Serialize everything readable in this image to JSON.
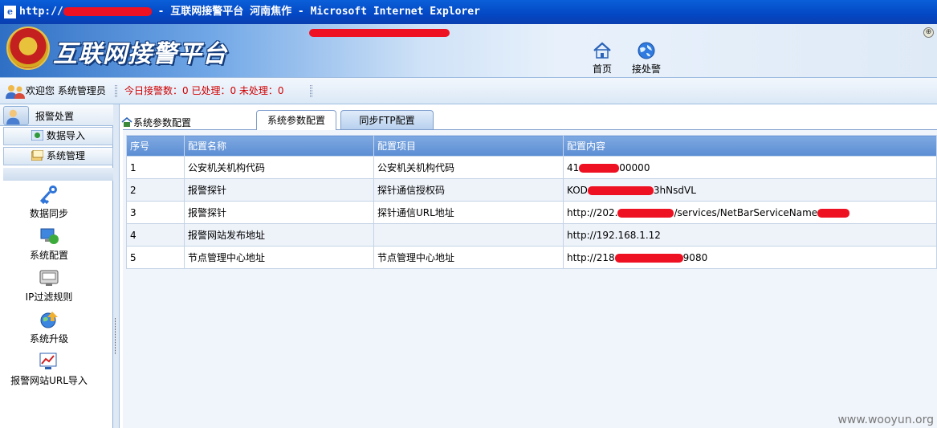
{
  "window": {
    "title_prefix": "http://",
    "title_suffix": " - 互联网接警平台 河南焦作 - Microsoft Internet Explorer"
  },
  "banner": {
    "title": "互联网接警平台",
    "nav": [
      {
        "label": "首页",
        "icon": "home-icon"
      },
      {
        "label": "接处警",
        "icon": "globe-icon"
      }
    ]
  },
  "status": {
    "welcome": "欢迎您  系统管理员",
    "stats": "今日接警数：0  已处理：0  未处理：0"
  },
  "sidebar": {
    "header": "报警处置",
    "buttons": [
      {
        "label": "数据导入",
        "icon": "data-import-icon"
      },
      {
        "label": "系统管理",
        "icon": "system-manage-icon"
      }
    ],
    "tools": [
      {
        "label": "数据同步",
        "icon": "key-icon"
      },
      {
        "label": "系统配置",
        "icon": "computer-network-icon"
      },
      {
        "label": "IP过滤规则",
        "icon": "ip-filter-icon"
      },
      {
        "label": "系统升级",
        "icon": "upgrade-globe-icon"
      },
      {
        "label": "报警网站URL导入",
        "icon": "chart-import-icon"
      }
    ]
  },
  "content": {
    "breadcrumb": "系统参数配置",
    "tabs": [
      "系统参数配置",
      "同步FTP配置"
    ],
    "table": {
      "headers": [
        "序号",
        "配置名称",
        "配置项目",
        "配置内容"
      ],
      "rows": [
        {
          "no": "1",
          "name": "公安机关机构代码",
          "item": "公安机关机构代码",
          "content_a": "41",
          "content_b": "00000"
        },
        {
          "no": "2",
          "name": "报警探针",
          "item": "探针通信授权码",
          "content_a": "KOD",
          "content_b": "3hNsdVL"
        },
        {
          "no": "3",
          "name": "报警探针",
          "item": "探针通信URL地址",
          "content_a": "http://202.",
          "content_b": "/services/NetBarServiceName"
        },
        {
          "no": "4",
          "name": "报警网站发布地址",
          "item": "",
          "content_a": "http://192.168.1.12",
          "content_b": ""
        },
        {
          "no": "5",
          "name": "节点管理中心地址",
          "item": "节点管理中心地址",
          "content_a": "http://218",
          "content_b": "9080"
        }
      ]
    }
  },
  "watermark": "www.wooyun.org",
  "colors": {
    "redaction": "#ee1122",
    "title_bar": "#0447c4",
    "table_header": "#6a98d9",
    "stats_text": "#d00000"
  }
}
